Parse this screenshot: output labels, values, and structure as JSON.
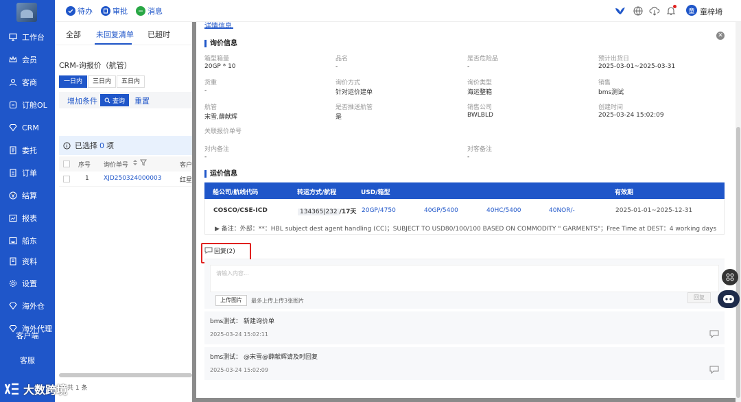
{
  "sidebar": {
    "items": [
      {
        "label": "工作台",
        "icon": "desktop-icon"
      },
      {
        "label": "会员",
        "icon": "crown-icon"
      },
      {
        "label": "客商",
        "icon": "user-icon"
      },
      {
        "label": "订舱OL",
        "icon": "booking-icon"
      },
      {
        "label": "CRM",
        "icon": "diamond-icon"
      },
      {
        "label": "委托",
        "icon": "doc-icon"
      },
      {
        "label": "订单",
        "icon": "order-icon"
      },
      {
        "label": "结算",
        "icon": "yen-icon"
      },
      {
        "label": "报表",
        "icon": "report-icon"
      },
      {
        "label": "船东",
        "icon": "ship-icon"
      },
      {
        "label": "资料",
        "icon": "folder-icon"
      },
      {
        "label": "设置",
        "icon": "gear-icon"
      },
      {
        "label": "海外仓",
        "icon": "warehouse-icon"
      },
      {
        "label": "海外代理",
        "icon": "agent-icon"
      }
    ],
    "extra_1": "客户端",
    "extra_2": "客服",
    "watermark": "大数跨境"
  },
  "topbar": {
    "todo": "待办",
    "approve": "审批",
    "message": "消息",
    "user": "童梓埼",
    "avatar_char": "童"
  },
  "leftpane": {
    "tabs": [
      "全部",
      "未回复清单",
      "已超时"
    ],
    "title": "CRM-询报价（航管）",
    "pills": [
      "一日内",
      "三日内",
      "五日内"
    ],
    "add_condition": "增加条件",
    "query": "查询",
    "reset": "重置",
    "selected_prefix": "已选择",
    "selected_count": "0",
    "selected_suffix": "项",
    "columns": [
      "序号",
      "询价单号",
      "客户"
    ],
    "rows": [
      {
        "no": "1",
        "id": "XJD250324000003",
        "customer": "红星"
      }
    ],
    "pager": "共 1 条"
  },
  "drawer": {
    "tab": "详情信息",
    "inquiry_title": "询价信息",
    "fields": [
      {
        "label": "箱型箱量",
        "value": "20GP * 10"
      },
      {
        "label": "品名",
        "value": "-"
      },
      {
        "label": "是否危险品",
        "value": "-"
      },
      {
        "label": "预计出货日",
        "value": "2025-03-01~2025-03-31"
      },
      {
        "label": "货重",
        "value": "-"
      },
      {
        "label": "询价方式",
        "value": "针对运价建单"
      },
      {
        "label": "询价类型",
        "value": "海运整箱"
      },
      {
        "label": "销售",
        "value": "bms测试"
      },
      {
        "label": "航管",
        "value": "宋雪,薛献辉"
      },
      {
        "label": "是否推送航管",
        "value": "是"
      },
      {
        "label": "销售公司",
        "value": "BWLBLD"
      },
      {
        "label": "创建时间",
        "value": "2025-03-24 15:02:09"
      },
      {
        "label": "关联报价单号",
        "value": ""
      },
      {
        "label": "对内备注",
        "value": "-"
      },
      {
        "label": "对客备注",
        "value": "-"
      }
    ],
    "rate_title": "运价信息",
    "rate_headers": [
      "船公司/航线代码",
      "转运方式/航程",
      "USD/箱型",
      "有效期"
    ],
    "rate_row": {
      "carrier": "COSCO/CSE-ICD",
      "route": "134365|232",
      "days": "/17天",
      "p1": "20GP/4750",
      "p2": "40GP/5400",
      "p3": "40HC/5400",
      "p4": "40NOR/-",
      "validity": "2025-01-01~2025-12-31",
      "note": "▶ 备注：外部：**：HBL subject dest agent handling (CC)；SUBJECT TO USD80/100/100 BASED ON COMMODITY \" GARMENTS\"；Free Time at DEST：4 working days"
    },
    "reply_tab": "回复(2)",
    "placeholder": "请输入内容...",
    "upload": "上传图片",
    "upload_hint": "最多上传上传3张图片",
    "reply_button": "回复",
    "comments": [
      {
        "text": "bms测试：  新建询价单",
        "time": "2025-03-24 15:02:11"
      },
      {
        "text": "bms测试：  @宋雪@薛献辉请及时回复",
        "time": "2025-03-24 15:02:09"
      }
    ]
  },
  "colors": {
    "primary": "#1f56c9",
    "highlight": "#e0211f"
  }
}
